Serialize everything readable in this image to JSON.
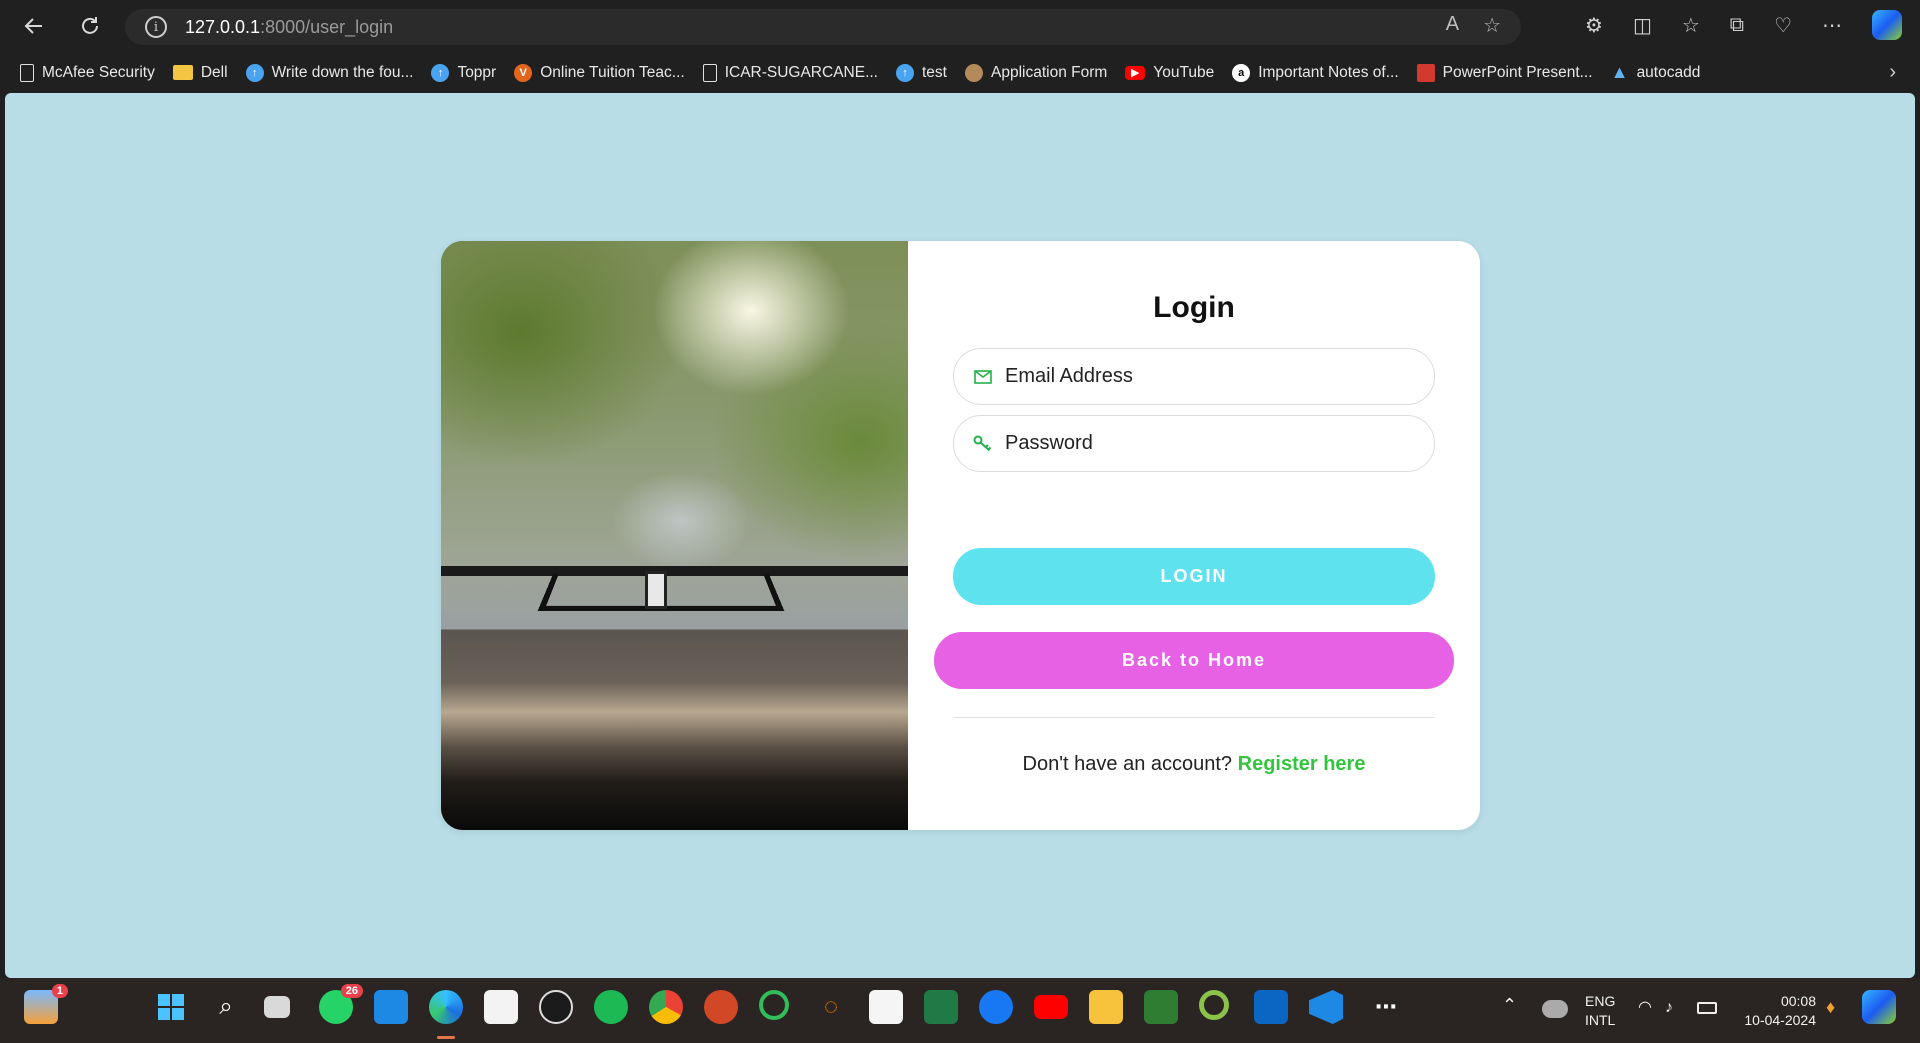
{
  "browser": {
    "url_host": "127.0.0.1",
    "url_path": ":8000/user_login"
  },
  "bookmarks": [
    {
      "label": "McAfee Security",
      "icon": "document-icon"
    },
    {
      "label": "Dell",
      "icon": "folder-icon"
    },
    {
      "label": "Write down the fou...",
      "icon": "upload-circle-icon"
    },
    {
      "label": "Toppr",
      "icon": "upload-circle-icon"
    },
    {
      "label": "Online Tuition Teac...",
      "icon": "v-logo-icon"
    },
    {
      "label": "ICAR-SUGARCANE...",
      "icon": "document-icon"
    },
    {
      "label": "test",
      "icon": "upload-circle-icon"
    },
    {
      "label": "Application Form",
      "icon": "seal-icon"
    },
    {
      "label": "YouTube",
      "icon": "youtube-icon"
    },
    {
      "label": "Important Notes of...",
      "icon": "a-logo-icon"
    },
    {
      "label": "PowerPoint Present...",
      "icon": "ppt-logo-icon"
    },
    {
      "label": "autocadd",
      "icon": "autocad-icon"
    }
  ],
  "login": {
    "title": "Login",
    "email_placeholder": "Email Address",
    "password_placeholder": "Password",
    "login_button": "LOGIN",
    "home_button": "Back to Home",
    "register_prompt": "Don't have an account?",
    "register_link": "Register here"
  },
  "taskbar": {
    "weather_badge": "1",
    "whatsapp_badge": "26",
    "lang_top": "ENG",
    "lang_bottom": "INTL",
    "time": "00:08",
    "date": "10-04-2024"
  },
  "colors": {
    "page_bg": "#b8dde6",
    "login_button": "#5ee3ee",
    "home_button": "#e761e4",
    "link": "#34c53f",
    "icon_green": "#22b14c"
  }
}
